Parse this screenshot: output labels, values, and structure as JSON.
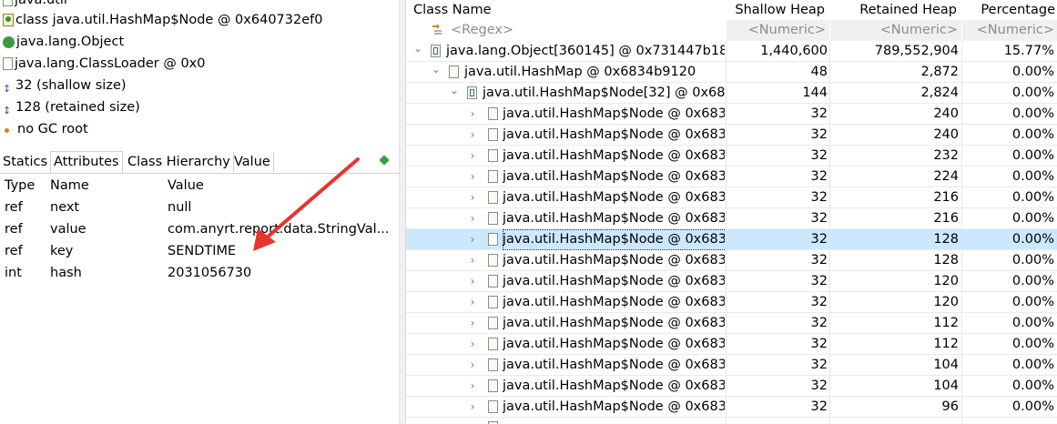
{
  "object_info": {
    "package": "java.util",
    "class_line": "class java.util.HashMap$Node @ 0x640732ef0",
    "superclass": "java.lang.Object",
    "classloader": "java.lang.ClassLoader @ 0x0",
    "shallow": "32 (shallow size)",
    "retained": "128 (retained size)",
    "gc_root": "no GC root"
  },
  "tabs": [
    "Statics",
    "Attributes",
    "Class Hierarchy",
    "Value"
  ],
  "active_tab": "Attributes",
  "attributes": {
    "headers": {
      "type": "Type",
      "name": "Name",
      "value": "Value"
    },
    "rows": [
      {
        "type": "ref",
        "name": "next",
        "value": "null"
      },
      {
        "type": "ref",
        "name": "value",
        "value": "com.anyrt.report.data.StringVal..."
      },
      {
        "type": "ref",
        "name": "key",
        "value": "SENDTIME"
      },
      {
        "type": "int",
        "name": "hash",
        "value": "2031056730"
      }
    ]
  },
  "annotation_color": "#e8342b",
  "selection_color": "#cce8ff",
  "table": {
    "headers": {
      "class_name": "Class Name",
      "shallow": "Shallow Heap",
      "retained": "Retained Heap",
      "percentage": "Percentage"
    },
    "filters": {
      "class_name": "<Regex>",
      "shallow": "<Numeric>",
      "retained": "<Numeric>",
      "percentage": "<Numeric>"
    },
    "rows": [
      {
        "depth": 0,
        "expander": "expanded",
        "icon": "array",
        "name": "java.lang.Object[360145] @ 0x731447b18",
        "shallow": "1,440,600",
        "retained": "789,552,904",
        "pct": "15.77%"
      },
      {
        "depth": 1,
        "expander": "expanded",
        "icon": "object",
        "name": "java.util.HashMap @ 0x6834b9120",
        "shallow": "48",
        "retained": "2,872",
        "pct": "0.00%"
      },
      {
        "depth": 2,
        "expander": "expanded",
        "icon": "array",
        "name": "java.util.HashMap$Node[32] @ 0x68",
        "shallow": "144",
        "retained": "2,824",
        "pct": "0.00%"
      },
      {
        "depth": 3,
        "expander": "collapsed",
        "icon": "object",
        "name": "java.util.HashMap$Node @ 0x683",
        "shallow": "32",
        "retained": "240",
        "pct": "0.00%"
      },
      {
        "depth": 3,
        "expander": "collapsed",
        "icon": "object",
        "name": "java.util.HashMap$Node @ 0x683",
        "shallow": "32",
        "retained": "240",
        "pct": "0.00%"
      },
      {
        "depth": 3,
        "expander": "collapsed",
        "icon": "object",
        "name": "java.util.HashMap$Node @ 0x683",
        "shallow": "32",
        "retained": "232",
        "pct": "0.00%"
      },
      {
        "depth": 3,
        "expander": "collapsed",
        "icon": "object",
        "name": "java.util.HashMap$Node @ 0x683",
        "shallow": "32",
        "retained": "224",
        "pct": "0.00%"
      },
      {
        "depth": 3,
        "expander": "collapsed",
        "icon": "object",
        "name": "java.util.HashMap$Node @ 0x683",
        "shallow": "32",
        "retained": "216",
        "pct": "0.00%"
      },
      {
        "depth": 3,
        "expander": "collapsed",
        "icon": "object",
        "name": "java.util.HashMap$Node @ 0x683",
        "shallow": "32",
        "retained": "216",
        "pct": "0.00%"
      },
      {
        "depth": 3,
        "expander": "collapsed",
        "icon": "object",
        "name": "java.util.HashMap$Node @ 0x683",
        "shallow": "32",
        "retained": "128",
        "pct": "0.00%",
        "selected": true
      },
      {
        "depth": 3,
        "expander": "collapsed",
        "icon": "object",
        "name": "java.util.HashMap$Node @ 0x683",
        "shallow": "32",
        "retained": "128",
        "pct": "0.00%"
      },
      {
        "depth": 3,
        "expander": "collapsed",
        "icon": "object",
        "name": "java.util.HashMap$Node @ 0x683",
        "shallow": "32",
        "retained": "120",
        "pct": "0.00%"
      },
      {
        "depth": 3,
        "expander": "collapsed",
        "icon": "object",
        "name": "java.util.HashMap$Node @ 0x683",
        "shallow": "32",
        "retained": "120",
        "pct": "0.00%"
      },
      {
        "depth": 3,
        "expander": "collapsed",
        "icon": "object",
        "name": "java.util.HashMap$Node @ 0x683",
        "shallow": "32",
        "retained": "112",
        "pct": "0.00%"
      },
      {
        "depth": 3,
        "expander": "collapsed",
        "icon": "object",
        "name": "java.util.HashMap$Node @ 0x683",
        "shallow": "32",
        "retained": "112",
        "pct": "0.00%"
      },
      {
        "depth": 3,
        "expander": "collapsed",
        "icon": "object",
        "name": "java.util.HashMap$Node @ 0x683",
        "shallow": "32",
        "retained": "104",
        "pct": "0.00%"
      },
      {
        "depth": 3,
        "expander": "collapsed",
        "icon": "object",
        "name": "java.util.HashMap$Node @ 0x683",
        "shallow": "32",
        "retained": "104",
        "pct": "0.00%"
      },
      {
        "depth": 3,
        "expander": "collapsed",
        "icon": "object",
        "name": "java.util.HashMap$Node @ 0x683",
        "shallow": "32",
        "retained": "96",
        "pct": "0.00%"
      }
    ]
  }
}
